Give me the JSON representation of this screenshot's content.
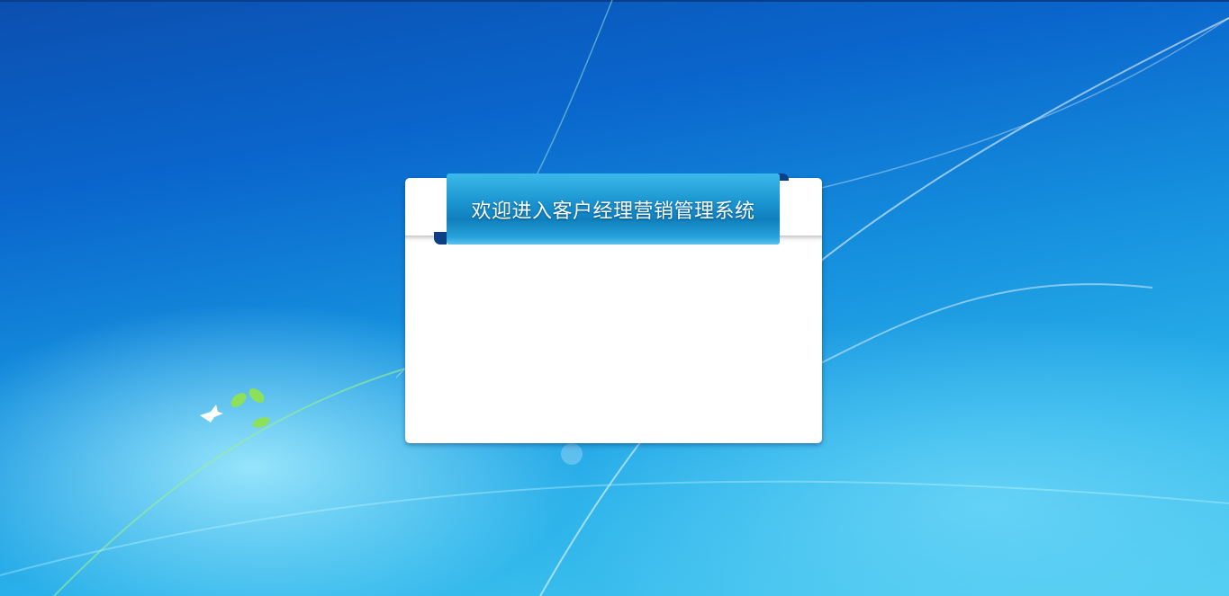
{
  "dialog": {
    "title": "欢迎进入客户经理营销管理系统"
  }
}
